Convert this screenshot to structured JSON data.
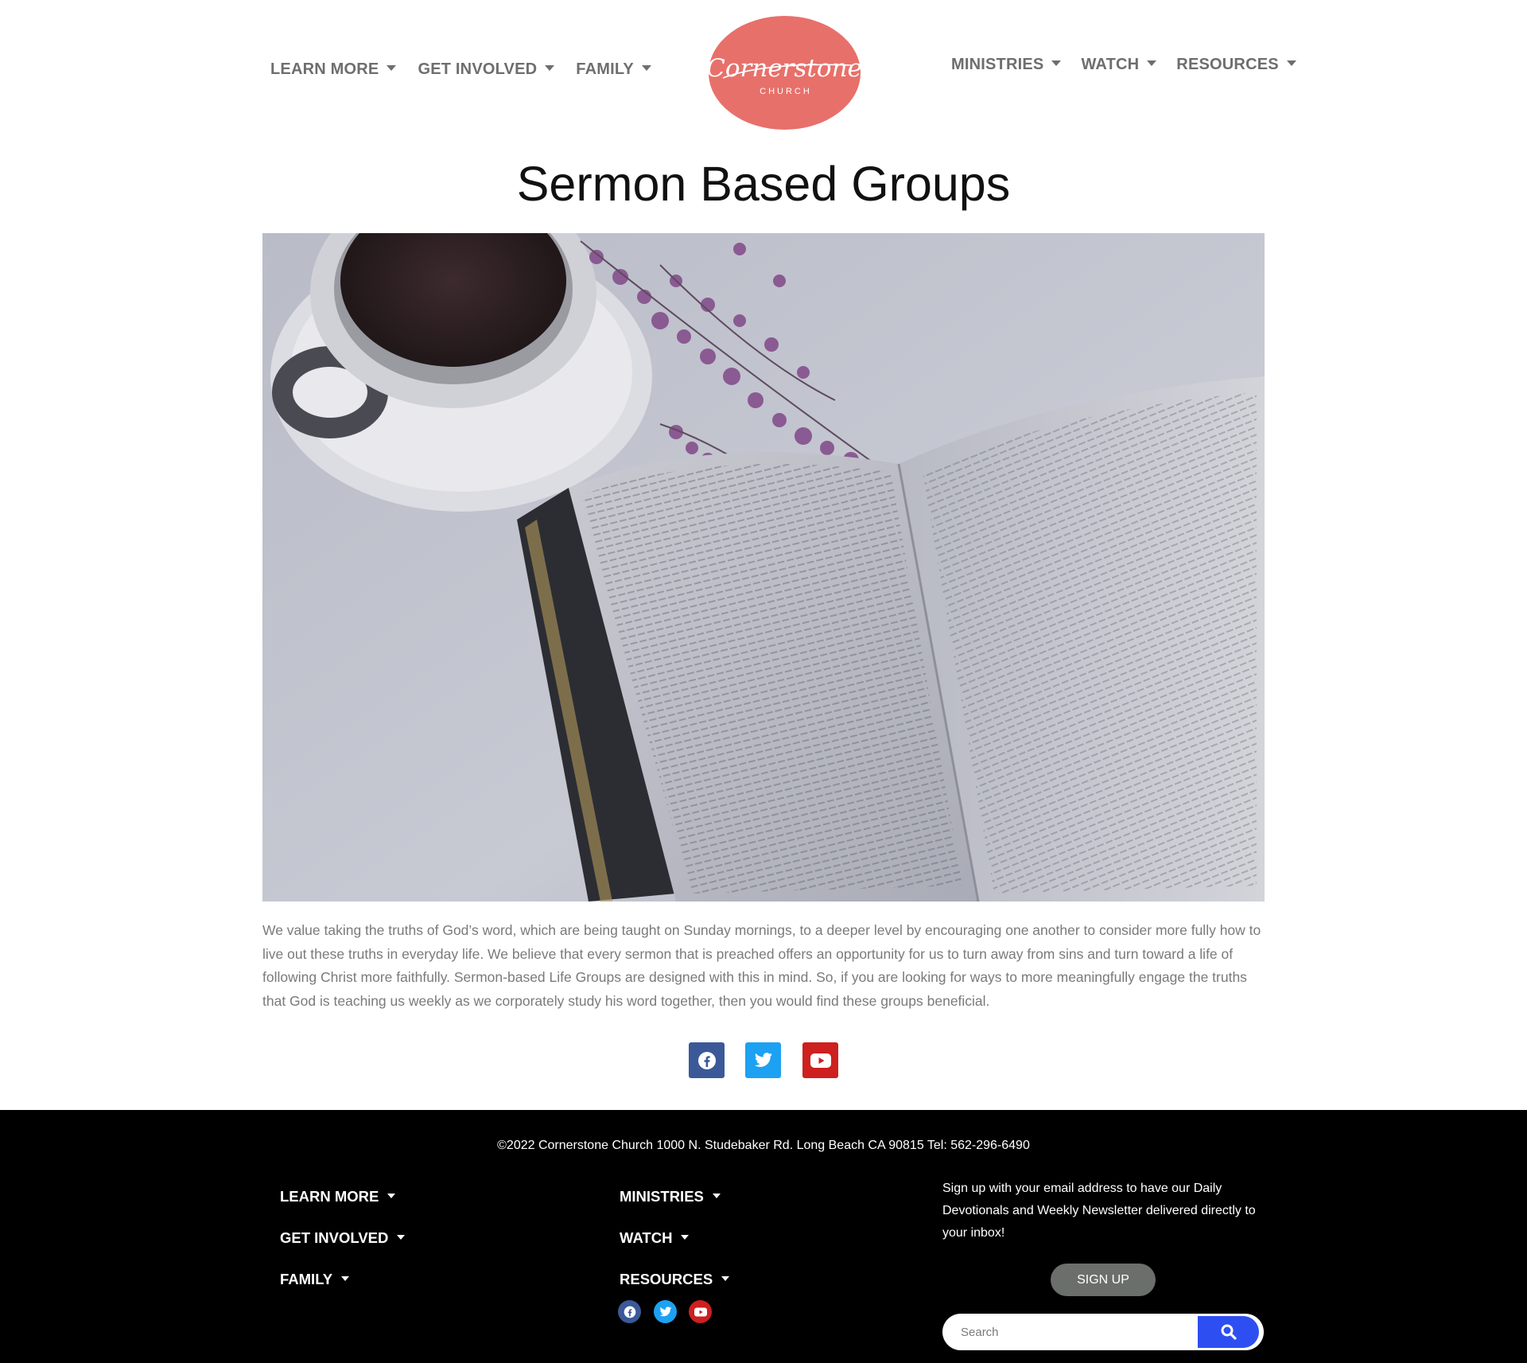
{
  "header": {
    "nav_left": [
      {
        "label": "LEARN MORE"
      },
      {
        "label": "GET INVOLVED"
      },
      {
        "label": "FAMILY"
      }
    ],
    "nav_right": [
      {
        "label": "MINISTRIES"
      },
      {
        "label": "WATCH"
      },
      {
        "label": "RESOURCES"
      }
    ],
    "logo": {
      "script": "Cornerstone",
      "sub": "CHURCH",
      "color": "#e8706a"
    }
  },
  "main": {
    "title": "Sermon Based Groups",
    "intro": "We value taking the truths of God’s word, which are being taught on Sunday mornings, to a deeper level by encouraging one another to consider more fully how to live out these truths in everyday life. We believe that every sermon that is preached offers an opportunity for us to turn away from sins and turn toward a life of following Christ more faithfully. Sermon-based Life Groups are designed with this in mind. So, if you are looking for ways to more meaningfully engage the truths that God is teaching us weekly as we corporately study his word together, then you would find these groups beneficial.",
    "social": [
      {
        "icon": "facebook-icon",
        "color": "#3b5998"
      },
      {
        "icon": "twitter-icon",
        "color": "#1da1f2"
      },
      {
        "icon": "youtube-icon",
        "color": "#cd201f"
      }
    ]
  },
  "footer": {
    "copyright": "©2022 Cornerstone Church 1000 N. Studebaker Rd. Long Beach CA 90815 Tel: 562-296-6490",
    "nav_col1": [
      {
        "label": "LEARN MORE"
      },
      {
        "label": "GET INVOLVED"
      },
      {
        "label": "FAMILY"
      }
    ],
    "nav_col2": [
      {
        "label": "MINISTRIES"
      },
      {
        "label": "WATCH"
      },
      {
        "label": "RESOURCES"
      }
    ],
    "signup_text": "Sign up with your email address to have our Daily Devotionals and Weekly Newsletter delivered directly to your inbox!",
    "signup_button": "SIGN UP",
    "search_placeholder": "Search",
    "search_button_color": "#2d4ff2"
  }
}
